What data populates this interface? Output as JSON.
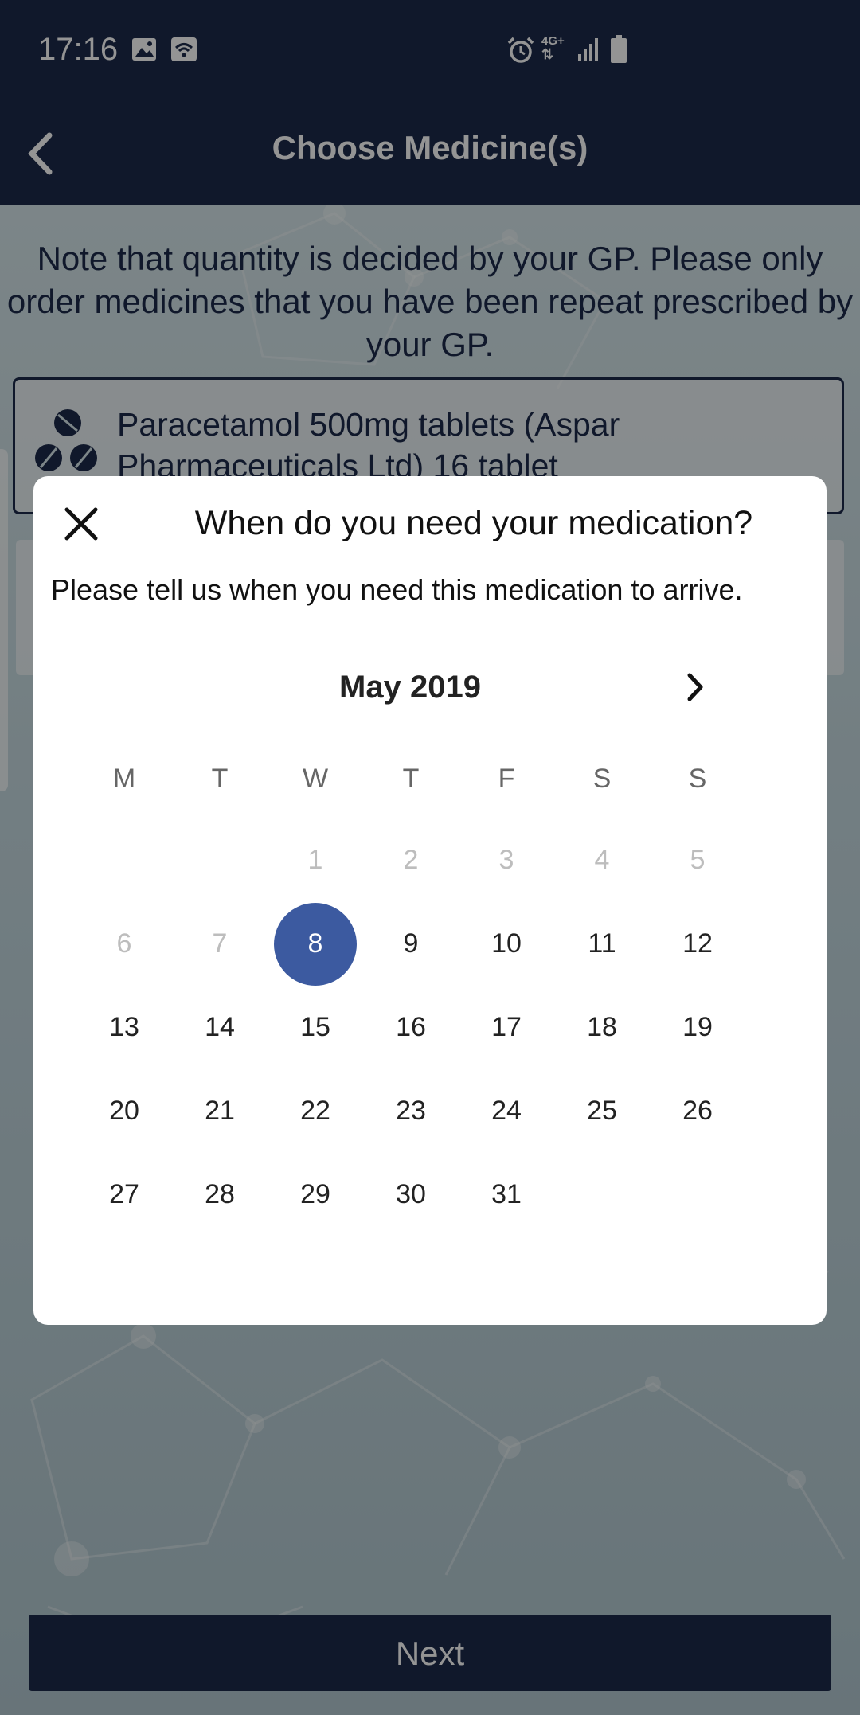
{
  "status_bar": {
    "time": "17:16",
    "network": "4G+",
    "icons": [
      "image-icon",
      "wifi-call-icon",
      "alarm-icon",
      "signal-icon",
      "battery-icon"
    ]
  },
  "app_bar": {
    "title": "Choose Medicine(s)",
    "back_icon": "chevron-left-icon"
  },
  "note": "Note that quantity is decided by your GP. Please only order medicines that you have been repeat prescribed by your GP.",
  "medicine_card": {
    "name": "Paracetamol 500mg tablets (Aspar Pharmaceuticals Ltd) 16 tablet",
    "icon": "pills-icon"
  },
  "next_button": {
    "label": "Next"
  },
  "dialog": {
    "title": "When do you need your medication?",
    "text": "Please tell us when you need this medication to arrive.",
    "close_icon": "close-icon",
    "calendar": {
      "month_label": "May 2019",
      "next_icon": "chevron-right-icon",
      "weekdays": [
        "M",
        "T",
        "W",
        "T",
        "F",
        "S",
        "S"
      ],
      "selected_day": "8",
      "weeks": [
        [
          {
            "d": ""
          },
          {
            "d": ""
          },
          {
            "d": "1",
            "disabled": true
          },
          {
            "d": "2",
            "disabled": true
          },
          {
            "d": "3",
            "disabled": true
          },
          {
            "d": "4",
            "disabled": true
          },
          {
            "d": "5",
            "disabled": true
          }
        ],
        [
          {
            "d": "6",
            "disabled": true
          },
          {
            "d": "7",
            "disabled": true
          },
          {
            "d": "8",
            "selected": true
          },
          {
            "d": "9"
          },
          {
            "d": "10"
          },
          {
            "d": "11"
          },
          {
            "d": "12"
          }
        ],
        [
          {
            "d": "13"
          },
          {
            "d": "14"
          },
          {
            "d": "15"
          },
          {
            "d": "16"
          },
          {
            "d": "17"
          },
          {
            "d": "18"
          },
          {
            "d": "19"
          }
        ],
        [
          {
            "d": "20"
          },
          {
            "d": "21"
          },
          {
            "d": "22"
          },
          {
            "d": "23"
          },
          {
            "d": "24"
          },
          {
            "d": "25"
          },
          {
            "d": "26"
          }
        ],
        [
          {
            "d": "27"
          },
          {
            "d": "28"
          },
          {
            "d": "29"
          },
          {
            "d": "30"
          },
          {
            "d": "31"
          },
          {
            "d": ""
          },
          {
            "d": ""
          }
        ]
      ]
    }
  },
  "colors": {
    "primary_navy": "#1c2a4a",
    "selected_day": "#3c5aa0",
    "disabled_day": "#bdbdbd"
  }
}
